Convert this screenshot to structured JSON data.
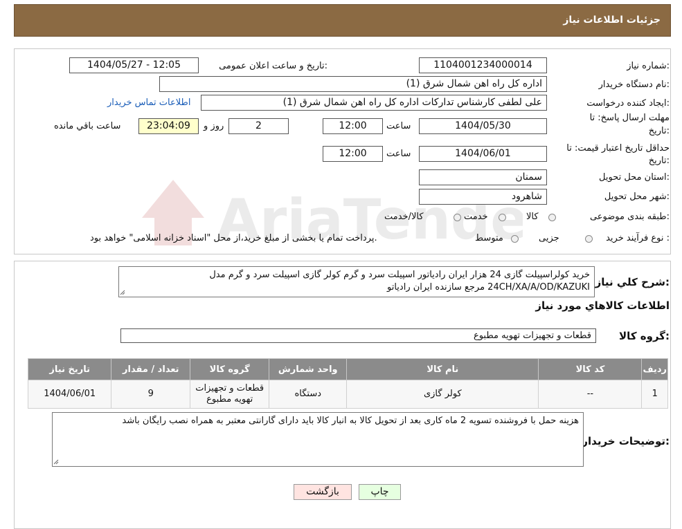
{
  "header": {
    "title": "جزئیات اطلاعات نیاز"
  },
  "form": {
    "need_number_label": "شماره نیاز:",
    "need_number": "1104001234000014",
    "announce_label": "تاریخ و ساعت اعلان عمومی:",
    "announce_value": "1404/05/27 - 12:05",
    "buyer_org_label": "نام دستگاه خریدار:",
    "buyer_org": "اداره کل راه اهن شمال شرق (1)",
    "requester_label": "ایجاد کننده درخواست:",
    "requester": "علی لطفی کارشناس تداركات اداره کل راه اهن شمال شرق (1)",
    "contact_link": "اطلاعات تماس خریدار",
    "send_deadline_label_1": "مهلت ارسال پاسخ: تا",
    "send_deadline_label_2": "تاریخ:",
    "send_date": "1404/05/30",
    "time_label": "ساعت",
    "send_time": "12:00",
    "days_value": "2",
    "days_label": "روز و",
    "remaining_time": "23:04:09",
    "remaining_label": "ساعت باقي مانده",
    "price_validity_label_1": "حداقل تاریخ اعتبار قیمت: تا",
    "price_validity_label_2": "تاریخ:",
    "price_date": "1404/06/01",
    "price_time": "12:00",
    "province_label": "استان محل تحویل:",
    "province": "سمنان",
    "city_label": "شهر محل تحویل:",
    "city": "شاهرود",
    "category_label": "طبقه بندی موضوعی:",
    "category_options": [
      "کالا",
      "خدمت",
      "کالا/خدمت"
    ],
    "process_label": "نوع فرآیند خرید :",
    "process_options": [
      "جزیی",
      "متوسط"
    ],
    "process_note": "پرداخت تمام یا بخشی از مبلغ خرید،از محل \"اسناد خزانه اسلامی\" خواهد بود."
  },
  "description": {
    "label": "شرح کلي نياز:",
    "text": "خرید کولراسپیلت  گازی 24 هزار ایران رادیاتور اسپیلت سرد و گرم کولر گازی اسپیلت سرد و گرم مدل 24CH/XA/A/OD/KAZUKI مرجع سازنده ایران رادیاتو"
  },
  "goods_info_title": "اطلاعات کالاهاي مورد نياز",
  "goods_group": {
    "label": "گروه کالا:",
    "value": "قطعات و تجهیزات تهویه مطبوع"
  },
  "table": {
    "headers": [
      "رديف",
      "کد کالا",
      "نام کالا",
      "واحد شمارش",
      "گروه کالا",
      "تعداد / مقدار",
      "تاریخ نیاز"
    ],
    "rows": [
      [
        "1",
        "--",
        "کولر گازی",
        "دستگاه",
        "قطعات و تجهیزات تهویه مطبوع",
        "9",
        "1404/06/01"
      ]
    ]
  },
  "buyer_notes": {
    "label": "توضیحات خریدار:",
    "text": "هزینه حمل با فروشنده تسویه 2 ماه کاری بعد از تحویل کالا به انبار کالا باید دارای گارانتی معتبر به همراه نصب رایگان باشد"
  },
  "buttons": {
    "print": "چاپ",
    "back": "بازگشت"
  },
  "watermark": {
    "text": "AriaTender.neT"
  },
  "colors": {
    "header": "#8B6A43",
    "table_header": "#8B8B8B",
    "link": "#1a5db8",
    "back_button": "#FFE4E1",
    "print_button": "#E6FFE0"
  }
}
